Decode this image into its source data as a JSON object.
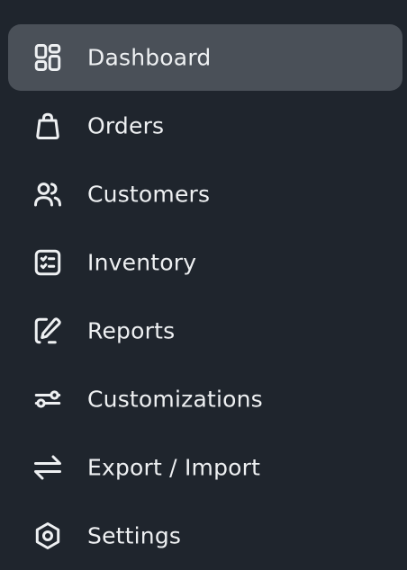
{
  "sidebar": {
    "items": [
      {
        "label": "Dashboard",
        "icon": "dashboard-grid-icon",
        "active": true
      },
      {
        "label": "Orders",
        "icon": "shopping-bag-icon",
        "active": false
      },
      {
        "label": "Customers",
        "icon": "users-icon",
        "active": false
      },
      {
        "label": "Inventory",
        "icon": "checklist-icon",
        "active": false
      },
      {
        "label": "Reports",
        "icon": "edit-pencil-icon",
        "active": false
      },
      {
        "label": "Customizations",
        "icon": "sliders-icon",
        "active": false
      },
      {
        "label": "Export / Import",
        "icon": "transfer-arrows-icon",
        "active": false
      },
      {
        "label": "Settings",
        "icon": "hexagon-gear-icon",
        "active": false
      }
    ]
  },
  "colors": {
    "background": "#1f252d",
    "active_background": "#4a5058",
    "text": "#eef0f2"
  }
}
